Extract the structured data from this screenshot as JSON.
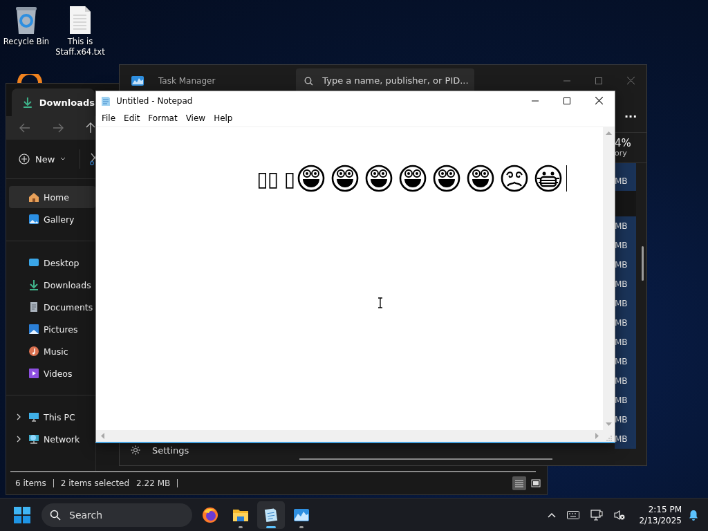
{
  "desktop_icons": [
    {
      "label": "Recycle Bin",
      "kind": "recycle"
    },
    {
      "label": "This is Staff.x64.txt",
      "kind": "textfile"
    }
  ],
  "file_explorer": {
    "tab": "Downloads",
    "new_button": "New",
    "sidebar": {
      "groups": [
        [
          {
            "label": "Home",
            "kind": "home",
            "selected": true
          },
          {
            "label": "Gallery",
            "kind": "gallery",
            "selected": false
          }
        ],
        [
          {
            "label": "Desktop",
            "kind": "desktop",
            "selected": false
          },
          {
            "label": "Downloads",
            "kind": "download",
            "selected": false
          },
          {
            "label": "Documents",
            "kind": "documents",
            "selected": false
          },
          {
            "label": "Pictures",
            "kind": "pictures",
            "selected": false
          },
          {
            "label": "Music",
            "kind": "music",
            "selected": false
          },
          {
            "label": "Videos",
            "kind": "videos",
            "selected": false
          }
        ]
      ],
      "locations": [
        {
          "label": "This PC",
          "kind": "pc",
          "expanded": false
        },
        {
          "label": "Network",
          "kind": "network",
          "expanded": false
        }
      ]
    },
    "status_bar": {
      "item_count": "6 items",
      "selection": "2 items selected",
      "size": "2.22 MB"
    }
  },
  "task_manager": {
    "title": "Task Manager",
    "search": {
      "placeholder": "Type a name, publisher, or PID..."
    },
    "more_button": "...",
    "column_header": {
      "value": "4%",
      "label": "ory"
    },
    "rows": [
      {
        "kind": "process",
        "memory": "MB"
      },
      {
        "kind": "group"
      },
      {
        "kind": "process",
        "memory": "MB"
      },
      {
        "kind": "process",
        "memory": "MB"
      },
      {
        "kind": "process",
        "memory": "MB"
      },
      {
        "kind": "process",
        "memory": "MB"
      },
      {
        "kind": "process",
        "memory": "MB"
      },
      {
        "kind": "process",
        "memory": "MB"
      },
      {
        "kind": "process",
        "memory": "MB"
      },
      {
        "kind": "process",
        "memory": "MB"
      },
      {
        "kind": "process",
        "memory": "MB"
      },
      {
        "kind": "process",
        "memory": "MB"
      },
      {
        "kind": "process",
        "memory": "MB"
      },
      {
        "kind": "process",
        "memory": "MB"
      }
    ],
    "settings": "Settings"
  },
  "notepad": {
    "title": "Untitled - Notepad",
    "menu": [
      "File",
      "Edit",
      "Format",
      "View",
      "Help"
    ],
    "text": "▯▯ ▯",
    "emoji": [
      {
        "kind": "grin"
      },
      {
        "kind": "grin"
      },
      {
        "kind": "grin"
      },
      {
        "kind": "grin"
      },
      {
        "kind": "grin"
      },
      {
        "kind": "grin"
      },
      {
        "kind": "dizzy"
      },
      {
        "kind": "mask"
      }
    ]
  },
  "taskbar": {
    "search": "Search",
    "apps": [
      {
        "kind": "firefox",
        "running": false,
        "selected": false
      },
      {
        "kind": "folder",
        "running": true,
        "selected": false
      },
      {
        "kind": "notepad",
        "running": true,
        "selected": true
      },
      {
        "kind": "taskmanager",
        "running": true,
        "selected": false
      }
    ],
    "time": "2:15 PM",
    "date": "2/13/2025"
  }
}
